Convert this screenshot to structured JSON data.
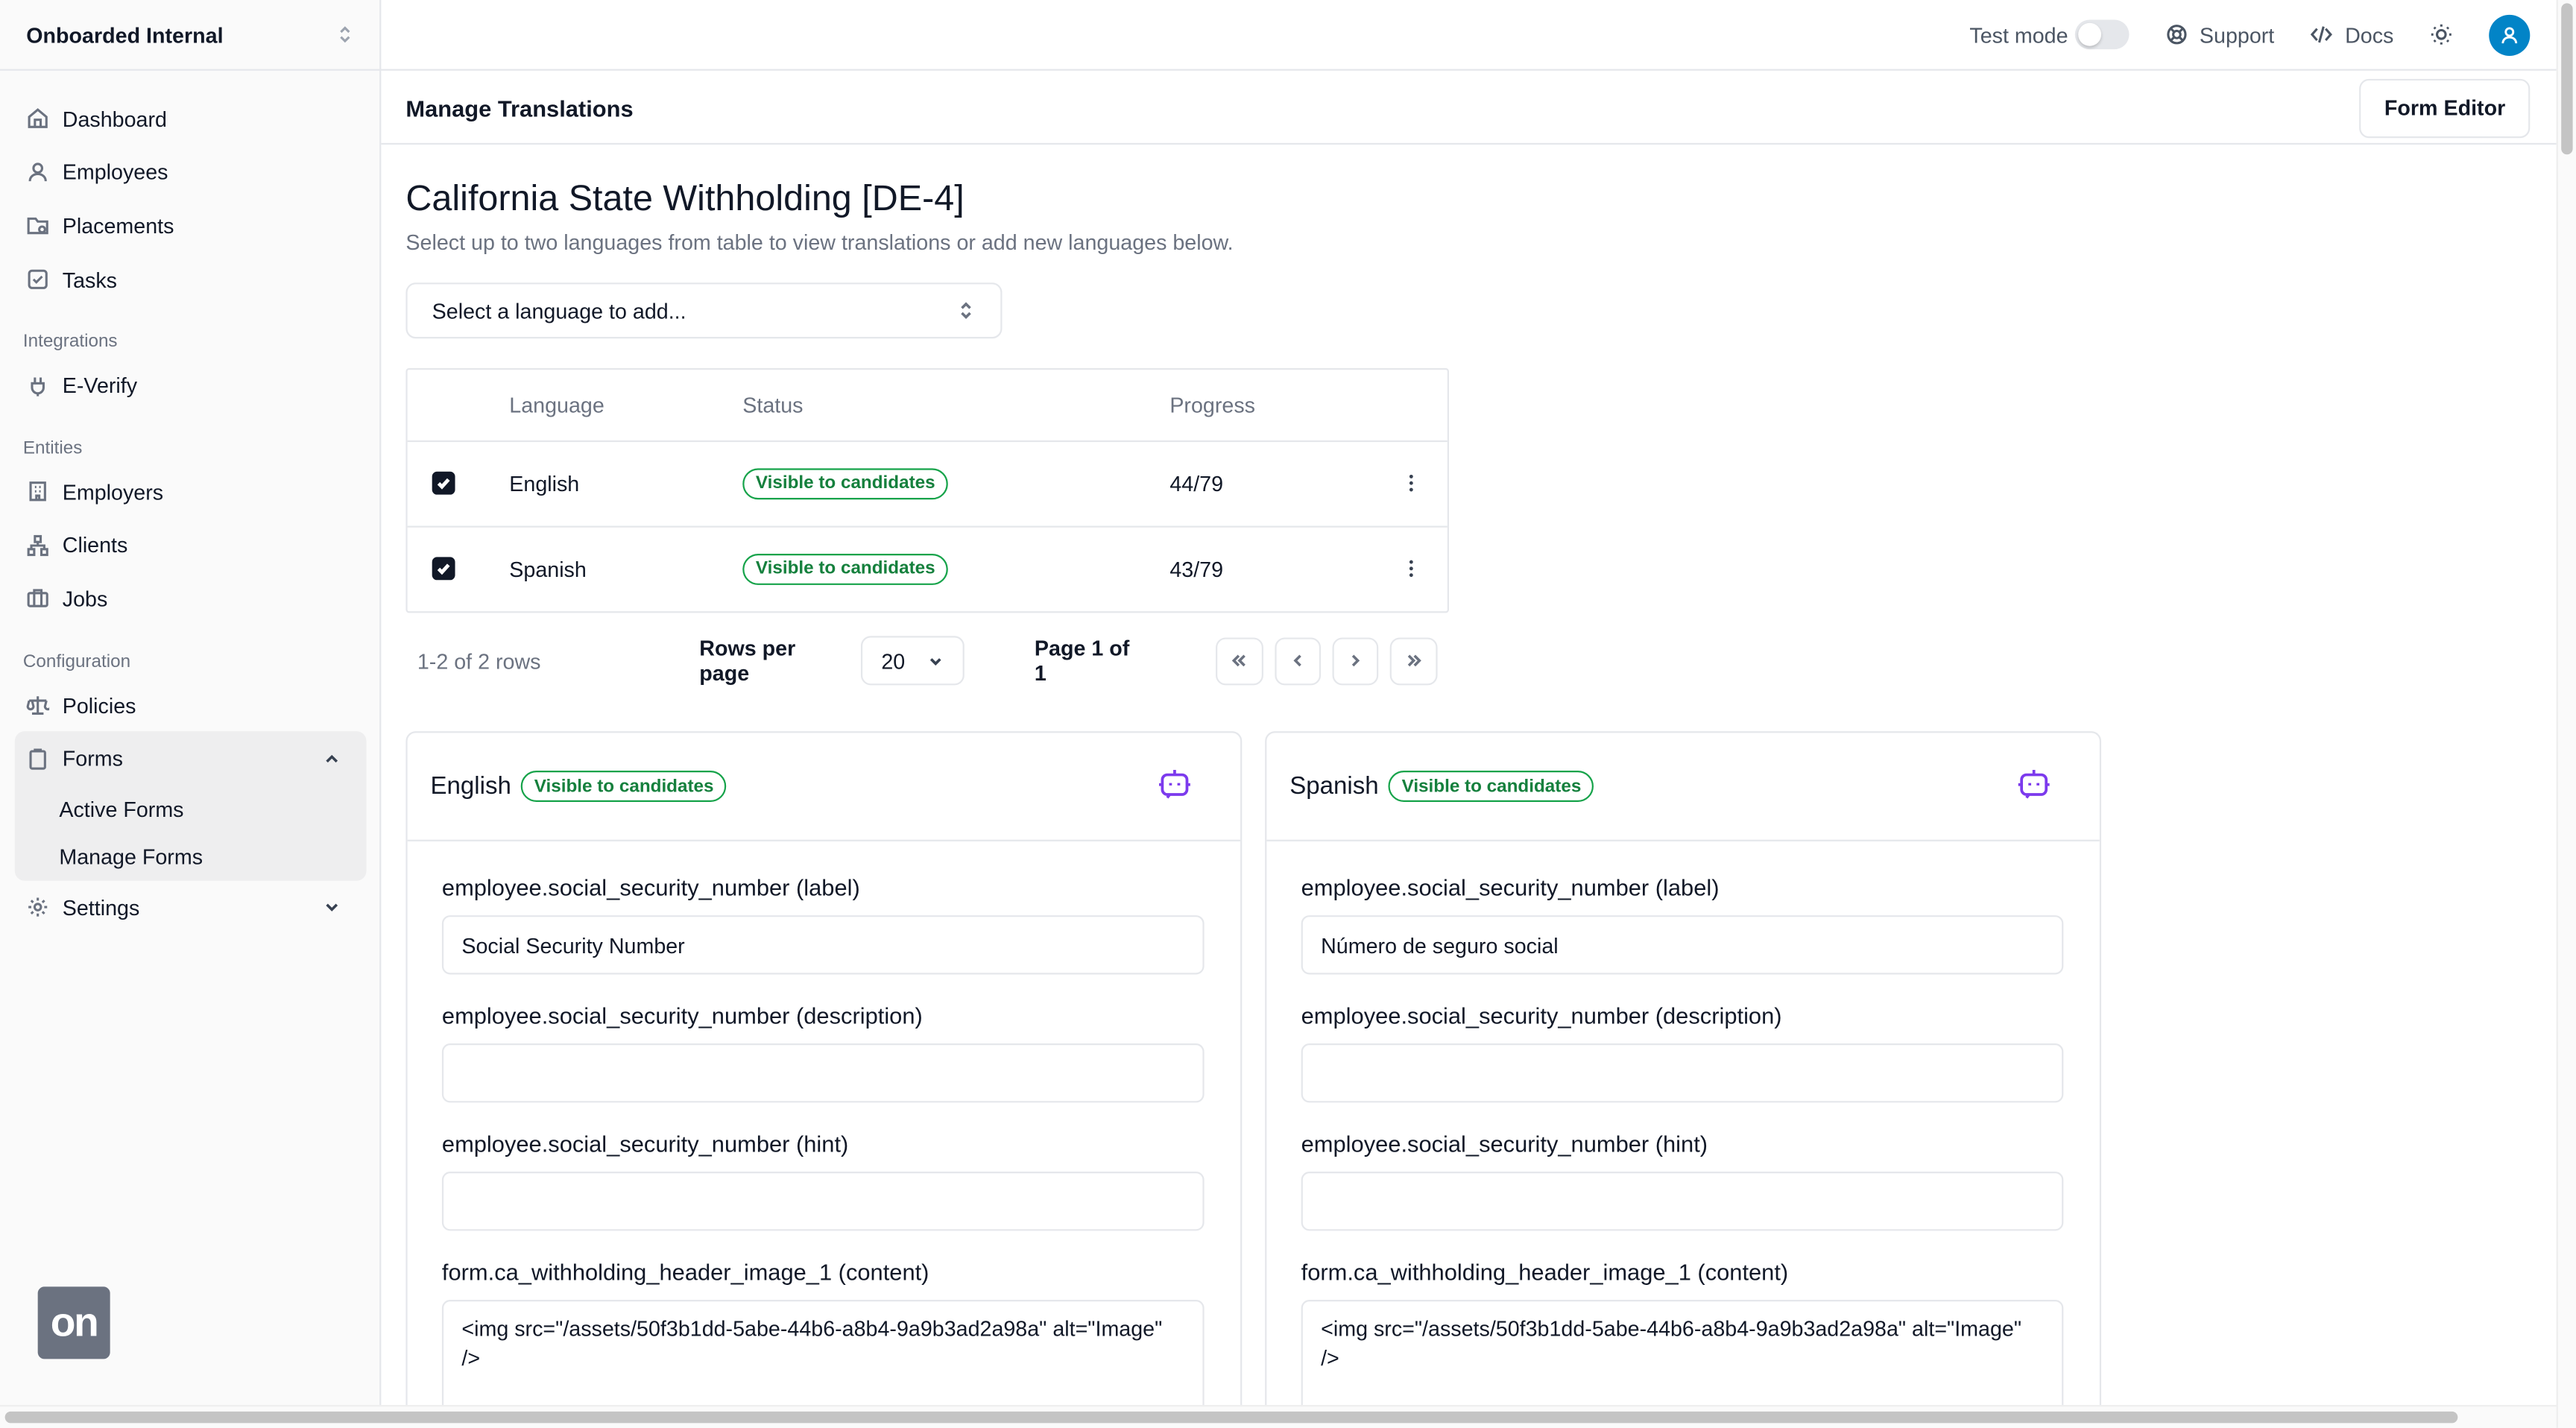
{
  "org": {
    "name": "Onboarded Internal"
  },
  "sidebar": {
    "main_items": [
      {
        "label": "Dashboard",
        "icon": "home-icon"
      },
      {
        "label": "Employees",
        "icon": "user-icon"
      },
      {
        "label": "Placements",
        "icon": "folder-icon"
      },
      {
        "label": "Tasks",
        "icon": "checkbox-icon"
      }
    ],
    "integrations_label": "Integrations",
    "integrations_items": [
      {
        "label": "E-Verify",
        "icon": "plug-icon"
      }
    ],
    "entities_label": "Entities",
    "entities_items": [
      {
        "label": "Employers",
        "icon": "building-icon"
      },
      {
        "label": "Clients",
        "icon": "network-icon"
      },
      {
        "label": "Jobs",
        "icon": "briefcase-icon"
      }
    ],
    "configuration_label": "Configuration",
    "configuration_items": [
      {
        "label": "Policies",
        "icon": "scale-icon"
      }
    ],
    "forms": {
      "label": "Forms",
      "sub_items": [
        "Active Forms",
        "Manage Forms"
      ]
    },
    "settings_label": "Settings",
    "logo_text": "on"
  },
  "topbar": {
    "test_mode_label": "Test mode",
    "test_mode_on": false,
    "support_label": "Support",
    "docs_label": "Docs"
  },
  "page": {
    "title": "Manage Translations",
    "form_editor_label": "Form Editor"
  },
  "form": {
    "title": "California State Withholding [DE-4]",
    "subtitle": "Select up to two languages from table to view translations or add new languages below.",
    "language_select_placeholder": "Select a language to add..."
  },
  "table": {
    "headers": {
      "language": "Language",
      "status": "Status",
      "progress": "Progress"
    },
    "rows": [
      {
        "checked": true,
        "language": "English",
        "status": "Visible to candidates",
        "progress": "44/79"
      },
      {
        "checked": true,
        "language": "Spanish",
        "status": "Visible to candidates",
        "progress": "43/79"
      }
    ],
    "pagination": {
      "count": "1-2 of 2 rows",
      "rows_per_page_label": "Rows per page",
      "rows_per_page_value": "20",
      "page_label": "Page 1 of 1"
    }
  },
  "panels": [
    {
      "language": "English",
      "status": "Visible to candidates",
      "fields": [
        {
          "label": "employee.social_security_number (label)",
          "value": "Social Security Number"
        },
        {
          "label": "employee.social_security_number (description)",
          "value": ""
        },
        {
          "label": "employee.social_security_number (hint)",
          "value": ""
        },
        {
          "label": "form.ca_withholding_header_image_1 (content)",
          "value": "<img src=\"/assets/50f3b1dd-5abe-44b6-a8b4-9a9b3ad2a98a\" alt=\"Image\" />"
        }
      ]
    },
    {
      "language": "Spanish",
      "status": "Visible to candidates",
      "fields": [
        {
          "label": "employee.social_security_number (label)",
          "value": "Número de seguro social"
        },
        {
          "label": "employee.social_security_number (description)",
          "value": ""
        },
        {
          "label": "employee.social_security_number (hint)",
          "value": ""
        },
        {
          "label": "form.ca_withholding_header_image_1 (content)",
          "value": "<img src=\"/assets/50f3b1dd-5abe-44b6-a8b4-9a9b3ad2a98a\" alt=\"Image\" />"
        }
      ]
    }
  ],
  "colors": {
    "accent": "#0284c7",
    "badge_green": "#16a34a",
    "bot_purple": "#7c3aed",
    "sidebar_bg": "#fafafa"
  }
}
